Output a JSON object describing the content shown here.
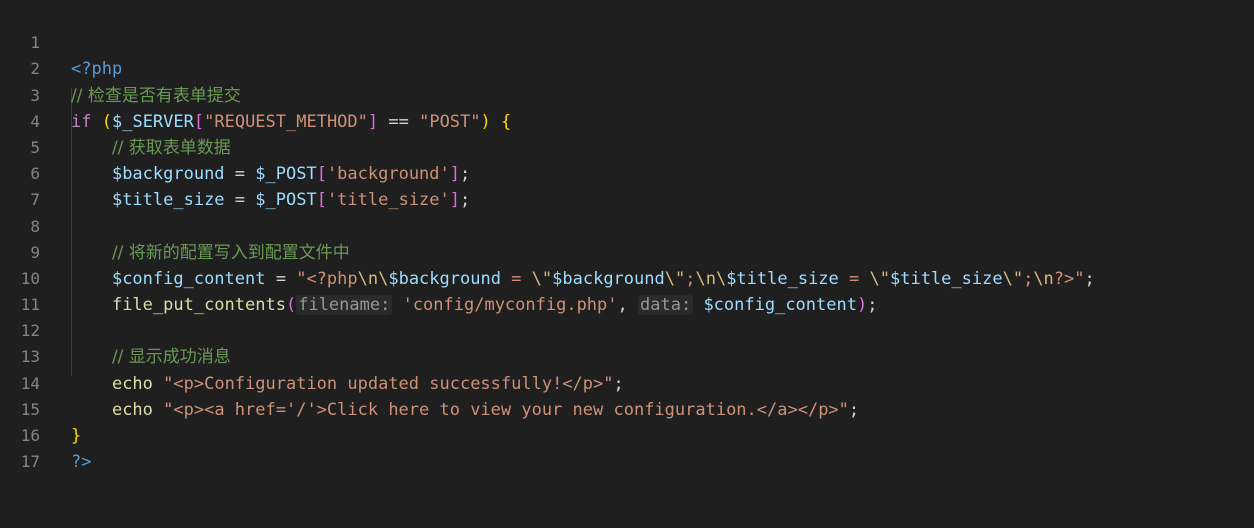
{
  "editor": {
    "language": "php",
    "line_numbers": [
      "1",
      "2",
      "3",
      "4",
      "5",
      "6",
      "7",
      "8",
      "9",
      "10",
      "11",
      "12",
      "13",
      "14",
      "15",
      "16",
      "17"
    ],
    "lines": {
      "l1": {
        "open": "<?php"
      },
      "l2": {
        "comment": "// 检查是否有表单提交"
      },
      "l3": {
        "kw_if": "if",
        "paren_open": "(",
        "var": "$_SERVER",
        "bracket_open": "[",
        "key": "\"REQUEST_METHOD\"",
        "bracket_close": "]",
        "op": " == ",
        "value": "\"POST\"",
        "paren_close": ")",
        "brace": " {"
      },
      "l4": {
        "comment": "// 获取表单数据"
      },
      "l5": {
        "var": "$background",
        "op": " = ",
        "src": "$_POST",
        "bracket_open": "[",
        "key": "'background'",
        "bracket_close": "]",
        "end": ";"
      },
      "l6": {
        "var": "$title_size",
        "op": " = ",
        "src": "$_POST",
        "bracket_open": "[",
        "key": "'title_size'",
        "bracket_close": "]",
        "end": ";"
      },
      "l8": {
        "comment": "// 将新的配置写入到配置文件中"
      },
      "l9": {
        "var": "$config_content",
        "op": " = ",
        "s1": "\"<?php",
        "e1": "\\n\\",
        "v1": "$background",
        "s2": " = ",
        "e2": "\\\"",
        "v2": "$background",
        "e3": "\\\"",
        "s3": ";",
        "e4": "\\n\\",
        "v3": "$title_size",
        "s4": " = ",
        "e5": "\\\"",
        "v4": "$title_size",
        "e6": "\\\"",
        "s5": ";",
        "e7": "\\n",
        "s6": "?>\"",
        "end": ";"
      },
      "l10": {
        "fn": "file_put_contents",
        "paren_open": "(",
        "hint1": "filename:",
        "arg1": "'config/myconfig.php'",
        "comma": ", ",
        "hint2": "data:",
        "arg2": "$config_content",
        "paren_close": ")",
        "end": ";"
      },
      "l12": {
        "comment": "// 显示成功消息"
      },
      "l13": {
        "kw": "echo",
        "str": "\"<p>Configuration updated successfully!</p>\"",
        "end": ";"
      },
      "l14": {
        "kw": "echo",
        "str": "\"<p><a href='/'>Click here to view your new configuration.</a></p>\"",
        "end": ";"
      },
      "l15": {
        "brace": "}"
      },
      "l16": {
        "close": "?>"
      }
    }
  },
  "colors": {
    "background": "#1f1f1f",
    "line_number": "#858585",
    "comment": "#6a9955",
    "keyword": "#569cd6",
    "control_keyword": "#c586c0",
    "variable": "#9cdcfe",
    "string": "#ce9178",
    "escape": "#d7ba7d",
    "function": "#dcdcaa"
  }
}
